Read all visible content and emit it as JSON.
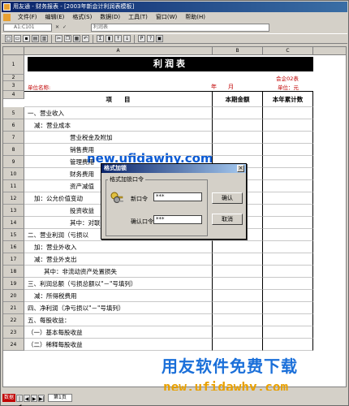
{
  "window": {
    "title": "用友通 - 财务报表 - [2003年新会计利润表模板]"
  },
  "menu": [
    {
      "label": "文件(F)"
    },
    {
      "label": "编辑(E)"
    },
    {
      "label": "格式(S)"
    },
    {
      "label": "数据(D)"
    },
    {
      "label": "工具(T)"
    },
    {
      "label": "窗口(W)"
    },
    {
      "label": "帮助(H)"
    }
  ],
  "formula_bar": {
    "cell_ref": "A1:C101",
    "formula_text": "利润表"
  },
  "toolbar": [
    {
      "icon": "new-icon",
      "glyph": "□"
    },
    {
      "icon": "open-icon",
      "glyph": "▭"
    },
    {
      "icon": "save-icon",
      "glyph": "▪"
    },
    {
      "icon": "print-icon",
      "glyph": "▤"
    },
    {
      "icon": "preview-icon",
      "glyph": "▥"
    },
    {
      "icon": "cut-icon",
      "glyph": "✂"
    },
    {
      "icon": "copy-icon",
      "glyph": "❐"
    },
    {
      "icon": "paste-icon",
      "glyph": "▦"
    },
    {
      "icon": "undo-icon",
      "glyph": "↶"
    },
    {
      "icon": "sum-icon",
      "glyph": "Σ"
    },
    {
      "icon": "chart-icon",
      "glyph": "▮"
    },
    {
      "icon": "sort-asc-icon",
      "glyph": "↑"
    },
    {
      "icon": "sort-desc-icon",
      "glyph": "↓"
    },
    {
      "icon": "p-icon",
      "glyph": "P"
    },
    {
      "icon": "help-icon",
      "glyph": "?"
    },
    {
      "icon": "zoom-icon",
      "glyph": "▣"
    }
  ],
  "columns": [
    "A",
    "B",
    "C"
  ],
  "rows": [
    "1",
    "2",
    "3",
    "4",
    "5",
    "6",
    "7",
    "8",
    "9",
    "10",
    "11",
    "12",
    "13",
    "14",
    "15",
    "16",
    "17",
    "18",
    "19",
    "20",
    "21",
    "22",
    "23",
    "24"
  ],
  "report": {
    "title": "利润表",
    "form_no": "会企02表",
    "unit_label": "单位名称:",
    "year_month": "年　　月",
    "currency": "单位：元",
    "headers": [
      "项　　目",
      "本期金额",
      "本年累计数"
    ],
    "items": [
      "一、营业收入",
      "减：营业成本",
      "营业税金及附加",
      "销售费用",
      "管理费用",
      "财务费用",
      "资产减值",
      "加：公允价值变动",
      "投资收益",
      "其中：对联",
      "二、营业利润（亏损以",
      "加：营业外收入",
      "减：营业外支出",
      "其中：非流动资产处置损失",
      "三、利润总额（亏损总额以\"－\"号填列）",
      "减：所得税费用",
      "四、净利润（净亏损以\"－\"号填列）",
      "五、每股收益：",
      "（一）基本每股收益",
      "（二）稀释每股收益"
    ]
  },
  "dialog": {
    "title": "格式加锁",
    "close_glyph": "×",
    "group_label": "格式加锁口令",
    "new_password_label": "新口令",
    "new_password_value": "***",
    "confirm_password_label": "确认口令",
    "confirm_password_value": "***",
    "ok_label": "确认",
    "cancel_label": "取消"
  },
  "status": {
    "mode_label": "数据",
    "sheet_tab": "第1页",
    "nav": [
      "|◀",
      "◀",
      "▶",
      "▶|"
    ]
  },
  "watermark": {
    "url_top": "new.ufidawhy.com",
    "title": "用友软件免费下载",
    "url_bottom": "new.ufidawhy.com"
  },
  "colors": {
    "title_bar": "#0a246a",
    "watermark_blue": "#1a6fd9",
    "watermark_orange": "#e8a000",
    "status_red": "#c00000"
  }
}
